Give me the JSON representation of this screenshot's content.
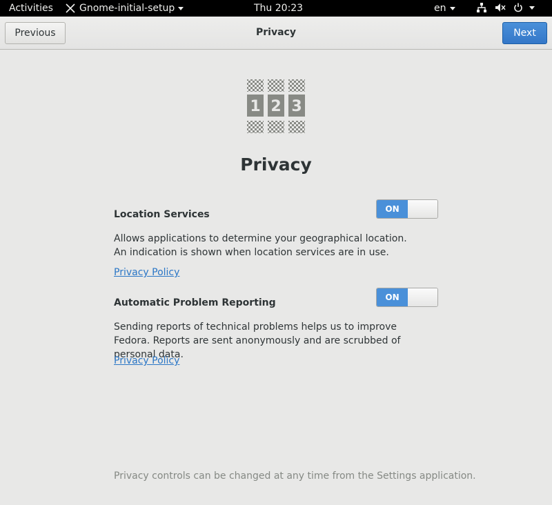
{
  "topbar": {
    "activities": "Activities",
    "app_name": "Gnome-initial-setup",
    "clock": "Thu 20:23",
    "language": "en"
  },
  "headerbar": {
    "previous_label": "Previous",
    "title": "Privacy",
    "next_label": "Next"
  },
  "main": {
    "heading": "Privacy",
    "icon": "privacy-123-icon",
    "sections": [
      {
        "title": "Location Services",
        "toggle_label": "ON",
        "toggle_on": true,
        "description": "Allows applications to determine your geographical location. An indication is shown when location services are in use.",
        "link": "Privacy Policy"
      },
      {
        "title": "Automatic Problem Reporting",
        "toggle_label": "ON",
        "toggle_on": true,
        "description": "Sending reports of technical problems helps us to improve Fedora. Reports are sent anonymously and are scrubbed of personal data.",
        "link": "Privacy Policy"
      }
    ],
    "footer_note": "Privacy controls can be changed at any time from the Settings application."
  },
  "colors": {
    "accent": "#4a90d9",
    "link": "#2a76c6",
    "background": "#e8e8e7"
  }
}
